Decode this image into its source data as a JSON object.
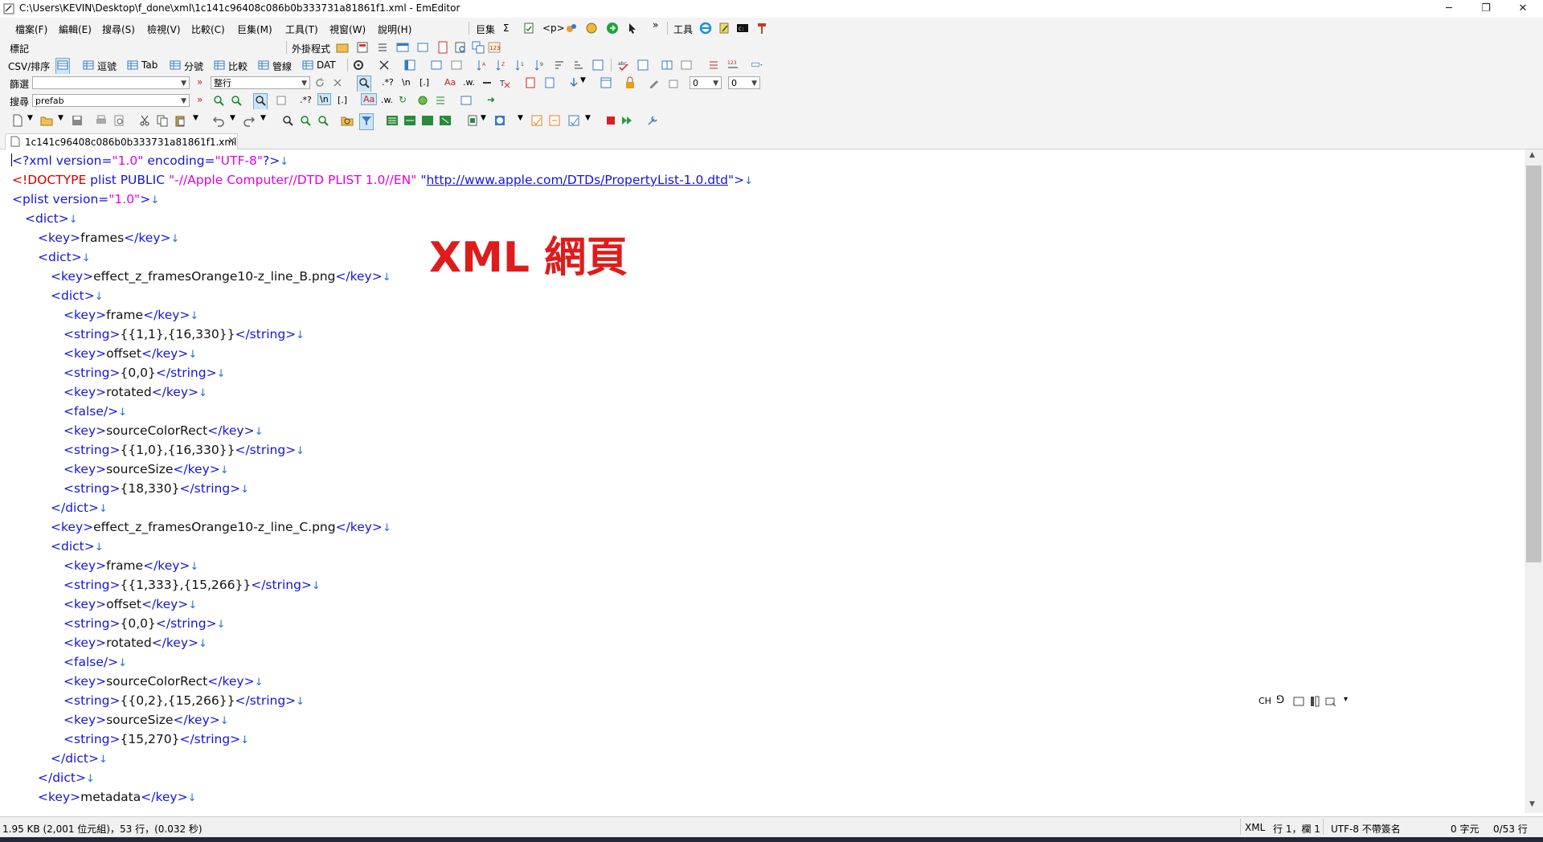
{
  "window": {
    "title": "C:\\Users\\KEVIN\\Desktop\\f_done\\xml\\1c141c96408c086b0b333731a81861f1.xml - EmEditor",
    "minimize": "─",
    "restore": "❐",
    "close": "✕"
  },
  "menu": [
    "檔案(F)",
    "編輯(E)",
    "搜尋(S)",
    "檢視(V)",
    "比較(C)",
    "巨集(M)",
    "工具(T)",
    "視窗(W)",
    "說明(H)"
  ],
  "toolbars": {
    "macro_label": "巨集",
    "sigma": "Σ",
    "tag": "<p>",
    "more": "»",
    "tools_label": "工具",
    "bookmark_label": "標記",
    "plugins_label": "外掛程式",
    "csv": {
      "label": "CSV/排序",
      "items": [
        "逗號",
        "Tab",
        "分號",
        "比較",
        "管線",
        "DAT"
      ]
    },
    "filter": {
      "label": "篩選",
      "mode_value": "整行",
      "count1": "0",
      "count2": "0"
    },
    "search": {
      "label": "搜尋",
      "value": "prefab"
    }
  },
  "tab": {
    "label": "1c141c96408c086b0b333731a81861f1.xml",
    "close": "×"
  },
  "watermark": "XML 網頁",
  "editor_lines": [
    "<?xml version=\"1.0\" encoding=\"UTF-8\"?>",
    "<!DOCTYPE plist PUBLIC \"-//Apple Computer//DTD PLIST 1.0//EN\" \"http://www.apple.com/DTDs/PropertyList-1.0.dtd\">",
    "<plist version=\"1.0\">",
    "<dict>",
    "<key>frames</key>",
    "<dict>",
    "<key>effect_z_framesOrange10-z_line_B.png</key>",
    "<dict>",
    "<key>frame</key>",
    "<string>{{1,1},{16,330}}</string>",
    "<key>offset</key>",
    "<string>{0,0}</string>",
    "<key>rotated</key>",
    "<false/>",
    "<key>sourceColorRect</key>",
    "<string>{{1,0},{16,330}}</string>",
    "<key>sourceSize</key>",
    "<string>{18,330}</string>",
    "</dict>",
    "<key>effect_z_framesOrange10-z_line_C.png</key>",
    "<dict>",
    "<key>frame</key>",
    "<string>{{1,333},{15,266}}</string>",
    "<key>offset</key>",
    "<string>{0,0}</string>",
    "<key>rotated</key>",
    "<false/>",
    "<key>sourceColorRect</key>",
    "<string>{{0,2},{15,266}}</string>",
    "<key>sourceSize</key>",
    "<string>{15,270}</string>",
    "</dict>",
    "</dict>",
    "<key>metadata</key>"
  ],
  "ime": {
    "lang": "CH",
    "mode": "⅁"
  },
  "status": {
    "size": "1.95 KB (2,001 位元組)，53 行，(0.032 秒)",
    "syntax": "XML",
    "position": "行 1，欄 1",
    "encoding": "UTF-8 不帶簽名",
    "selection": "0 字元",
    "lines": "0/53 行"
  },
  "colors": {
    "tag": "#1515d8",
    "attr_value": "#e000e0",
    "doctype": "#d00000",
    "watermark": "#e01b1b"
  }
}
